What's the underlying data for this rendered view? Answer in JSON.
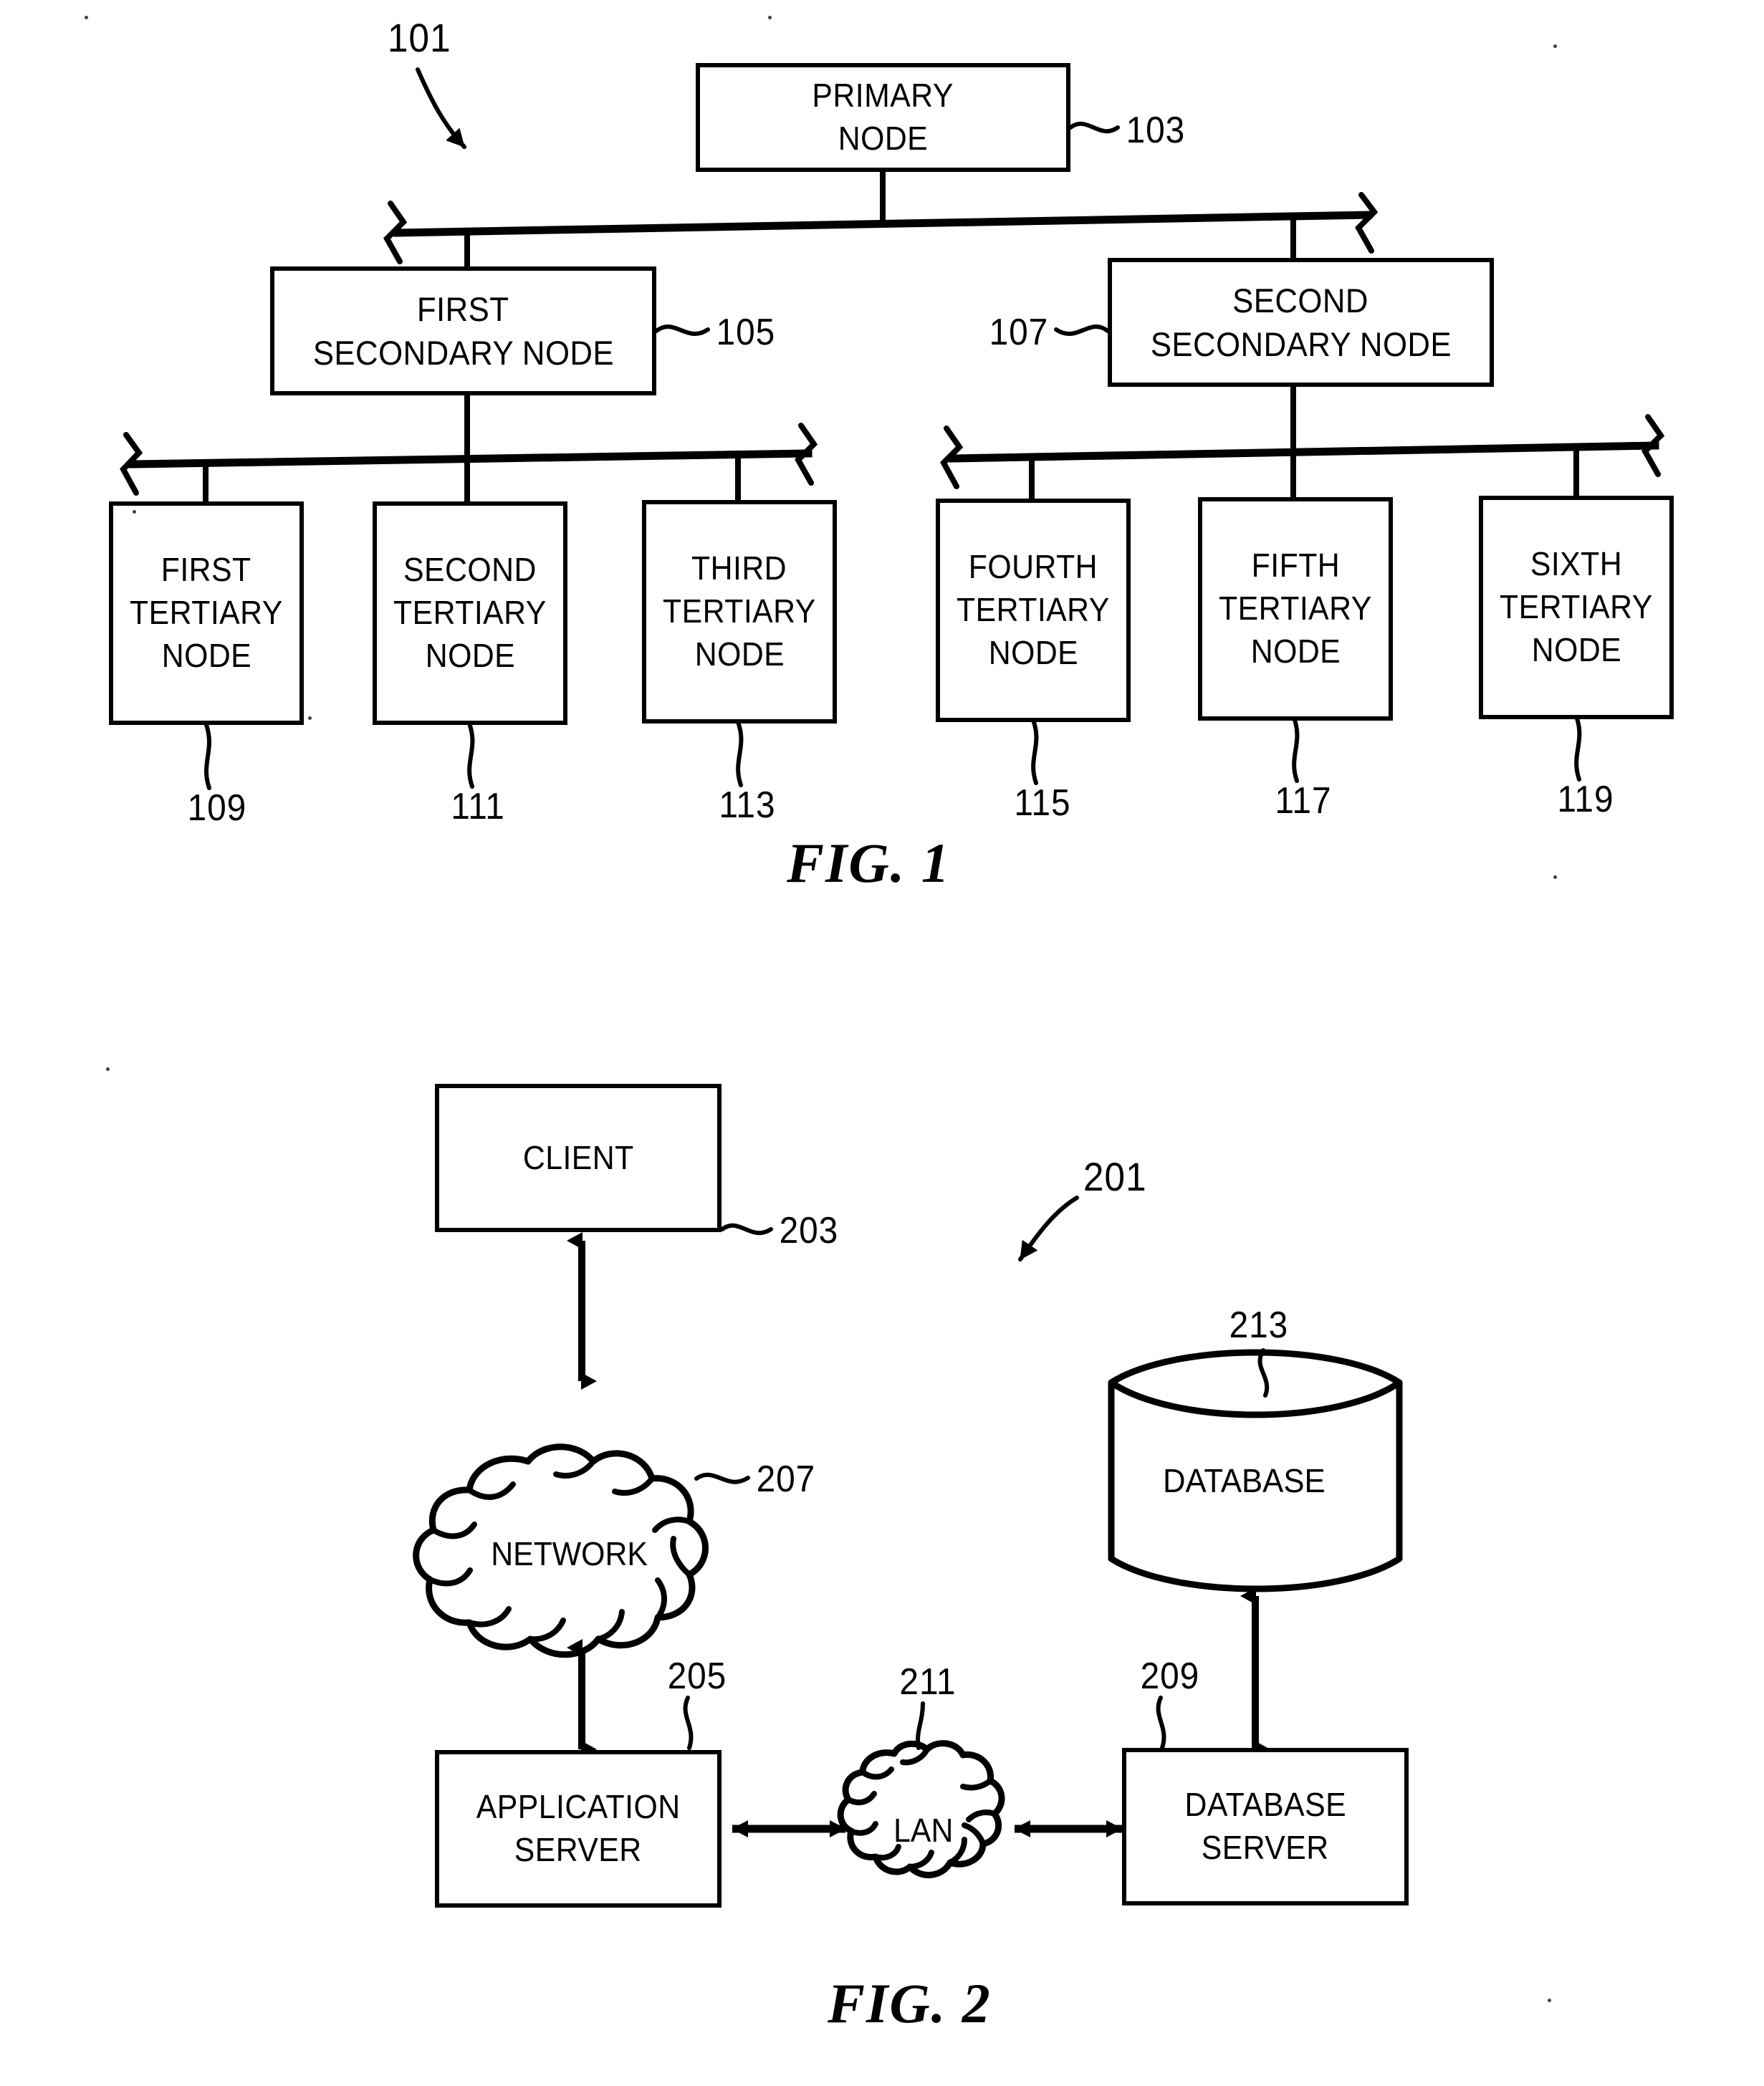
{
  "document": {
    "type": "patent-drawing-sheet",
    "figures": [
      "FIG. 1",
      "FIG. 2"
    ]
  },
  "figure1": {
    "caption": "FIG. 1",
    "system_ref": "101",
    "nodes": {
      "primary": {
        "lines": [
          "PRIMARY",
          "NODE"
        ],
        "ref": "103"
      },
      "secondary": [
        {
          "lines": [
            "FIRST",
            "SECONDARY NODE"
          ],
          "ref": "105"
        },
        {
          "lines": [
            "SECOND",
            "SECONDARY NODE"
          ],
          "ref": "107"
        }
      ],
      "tertiary": [
        {
          "lines": [
            "FIRST",
            "TERTIARY",
            "NODE"
          ],
          "ref": "109"
        },
        {
          "lines": [
            "SECOND",
            "TERTIARY",
            "NODE"
          ],
          "ref": "111"
        },
        {
          "lines": [
            "THIRD",
            "TERTIARY",
            "NODE"
          ],
          "ref": "113"
        },
        {
          "lines": [
            "FOURTH",
            "TERTIARY",
            "NODE"
          ],
          "ref": "115"
        },
        {
          "lines": [
            "FIFTH",
            "TERTIARY",
            "NODE"
          ],
          "ref": "117"
        },
        {
          "lines": [
            "SIXTH",
            "TERTIARY",
            "NODE"
          ],
          "ref": "119"
        }
      ]
    }
  },
  "figure2": {
    "caption": "FIG. 2",
    "system_ref": "201",
    "elements": {
      "client": {
        "label": "CLIENT",
        "ref": "203"
      },
      "network": {
        "label": "NETWORK",
        "ref": "207"
      },
      "application_server": {
        "lines": [
          "APPLICATION",
          "SERVER"
        ],
        "ref": "205"
      },
      "lan": {
        "label": "LAN",
        "ref": "211"
      },
      "database_server": {
        "lines": [
          "DATABASE",
          "SERVER"
        ],
        "ref": "209"
      },
      "database": {
        "label": "DATABASE",
        "ref": "213"
      }
    }
  },
  "colors": {
    "ink": "#000000",
    "paper": "#ffffff"
  }
}
